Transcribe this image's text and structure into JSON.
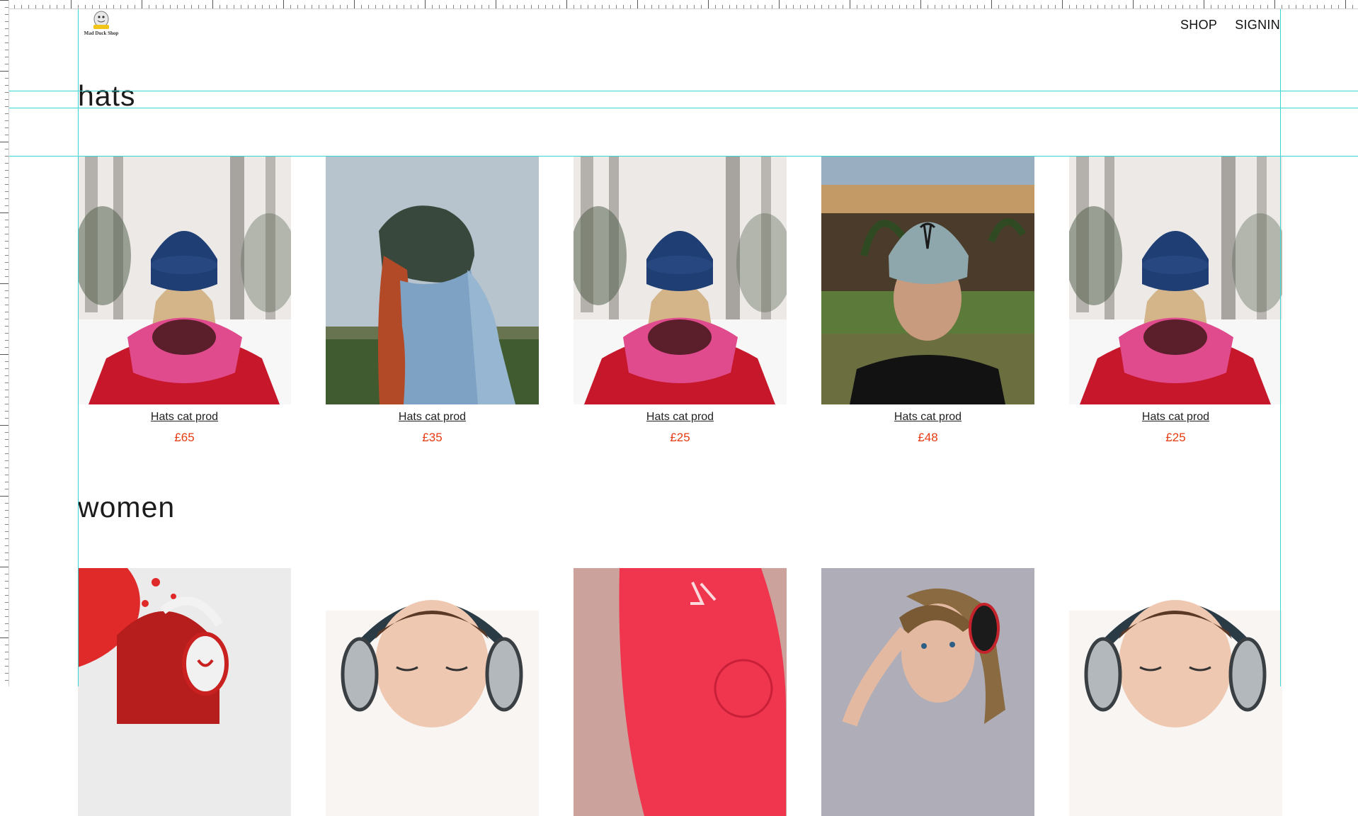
{
  "brand": {
    "name": "Mad Duck Shop",
    "logo_icon": "duck-logo-icon"
  },
  "nav": {
    "shop": "SHOP",
    "signin": "SIGNIN"
  },
  "sections": [
    {
      "title": "hats",
      "products": [
        {
          "name": "Hats cat prod",
          "price": "£65",
          "image": "blue-beanie-snow-photo"
        },
        {
          "name": "Hats cat prod",
          "price": "£35",
          "image": "green-beanie-redhead-photo"
        },
        {
          "name": "Hats cat prod",
          "price": "£25",
          "image": "blue-beanie-snow-photo"
        },
        {
          "name": "Hats cat prod",
          "price": "£48",
          "image": "grey-cap-crowd-photo"
        },
        {
          "name": "Hats cat prod",
          "price": "£25",
          "image": "blue-beanie-snow-photo"
        }
      ]
    },
    {
      "title": "women",
      "products": [
        {
          "image": "red-splash-headphones-photo"
        },
        {
          "image": "woman-silver-headphones-photo"
        },
        {
          "image": "red-speaker-photo"
        },
        {
          "image": "woman-black-headphones-photo"
        },
        {
          "image": "woman-silver-headphones-photo"
        }
      ]
    }
  ],
  "colors": {
    "price": "#e63b11",
    "guide": "#38d6d3",
    "text": "#1b1b1b"
  }
}
